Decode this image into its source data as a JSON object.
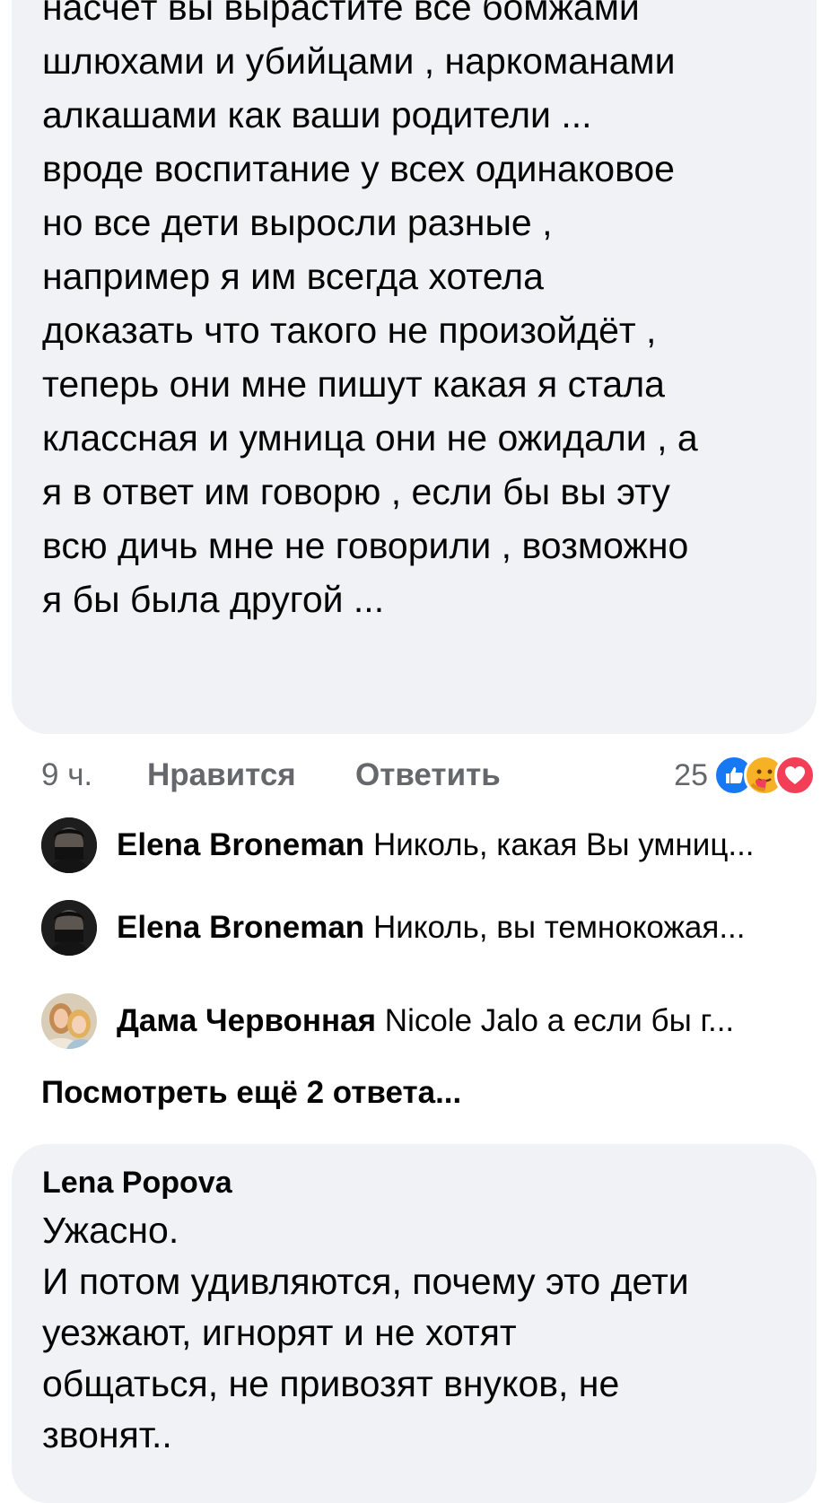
{
  "first_comment": {
    "lines": [
      "насчёт вы вырастите все бомжами",
      "шлюхами и убийцами , наркоманами",
      "алкашами как ваши родители ...",
      "вроде воспитание у всех одинаковое",
      "но все дети выросли разные ,",
      "например я им всегда хотела",
      "доказать что такого не произойдёт ,",
      "теперь они мне пишут какая я стала",
      "классная и умница они не ожидали , а",
      "я в ответ им говорю , если бы вы эту",
      "всю дичь мне не говорили , возможно",
      "я бы была другой ..."
    ],
    "time": "9 ч.",
    "like_label": "Нравится",
    "reply_label": "Ответить",
    "reaction_count": "25",
    "reaction_icons": [
      "like-icon",
      "care-icon",
      "love-icon"
    ],
    "reaction_colors": {
      "like": "#1877f2",
      "care": "#f7b125",
      "love": "#f33e58"
    }
  },
  "replies": [
    {
      "author": "Elena Broneman",
      "text": "Николь, какая Вы умниц..."
    },
    {
      "author": "Elena Broneman",
      "text": "Николь, вы темнокожая..."
    },
    {
      "author": "Дама Червонная",
      "text": "Nicole Jalo  а если бы г..."
    }
  ],
  "view_more_label": "Посмотреть ещё 2 ответа...",
  "second_comment": {
    "author": "Lena Popova",
    "lines": [
      "Ужасно.",
      "И потом удивляются, почему это дети",
      "уезжают, игнорят и не хотят",
      "общаться, не привозят внуков, не",
      "звонят.."
    ]
  }
}
